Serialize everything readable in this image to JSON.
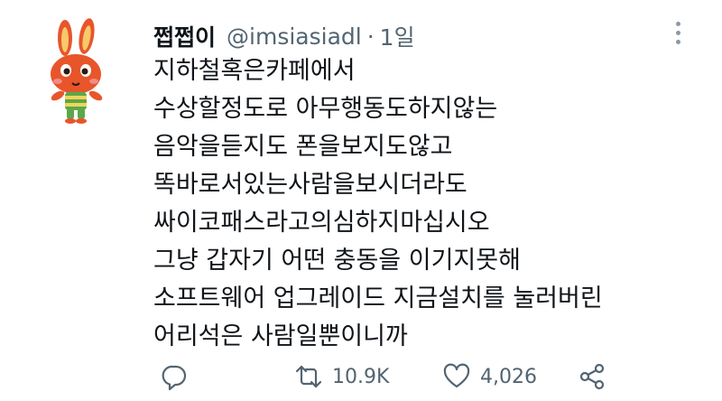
{
  "tweet": {
    "display_name": "쩝쩝이",
    "handle": "@imsiasiadl",
    "separator": "·",
    "time": "1일",
    "lines": [
      "지하철혹은카페에서",
      "수상할정도로 아무행동도하지않는",
      "음악을듣지도 폰을보지도않고",
      "똑바로서있는사람을보시더라도",
      "싸이코패스라고의심하지마십시오",
      "그냥 갑자기 어떤 충동을 이기지못해",
      "소프트웨어 업그레이드 지금설치를 눌러버린",
      "어리석은 사람일뿐이니까"
    ]
  },
  "actions": {
    "reply_icon": "reply-icon",
    "retweet_icon": "retweet-icon",
    "retweet_count": "10.9K",
    "like_icon": "heart-icon",
    "like_count": "4,026",
    "share_icon": "share-icon"
  },
  "colors": {
    "text": "#0f1419",
    "secondary": "#536471",
    "background": "#ffffff"
  }
}
